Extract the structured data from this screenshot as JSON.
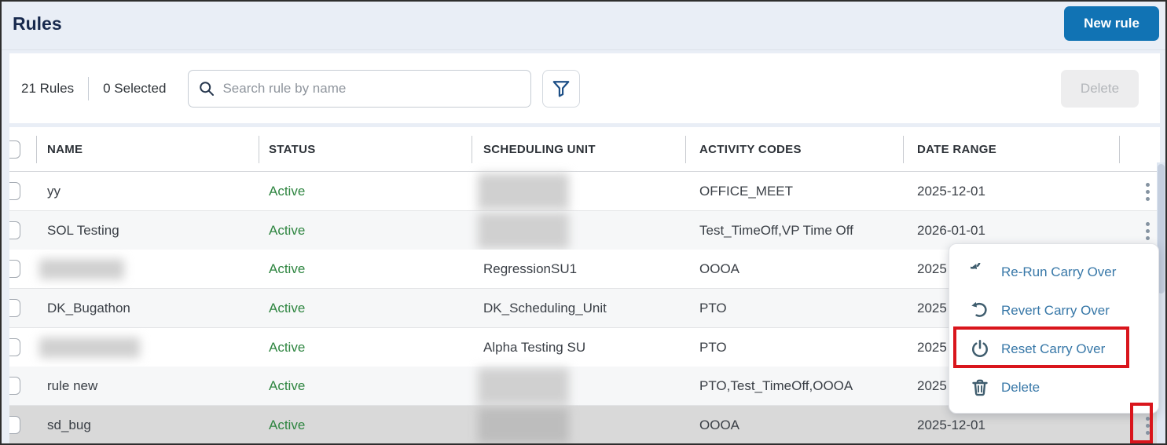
{
  "page": {
    "title": "Rules"
  },
  "header": {
    "new_rule_label": "New rule"
  },
  "toolbar": {
    "rules_count": "21 Rules",
    "selected_count": "0 Selected",
    "search_placeholder": "Search rule by name",
    "search_icon": "magnifier",
    "filter_icon": "filter-funnel",
    "delete_label": "Delete",
    "delete_enabled": false
  },
  "table": {
    "columns": [
      "NAME",
      "STATUS",
      "SCHEDULING UNIT",
      "ACTIVITY CODES",
      "DATE RANGE"
    ],
    "row_action_icon": "kebab-menu",
    "rows": [
      {
        "name": "yy",
        "status": "Active",
        "scheduling_unit": "",
        "scheduling_unit_redacted": true,
        "activity_codes": "OFFICE_MEET",
        "date_range": "2025-12-01",
        "selected": false
      },
      {
        "name": "SOL Testing",
        "status": "Active",
        "scheduling_unit": "",
        "scheduling_unit_redacted": true,
        "activity_codes": "Test_TimeOff,VP Time Off",
        "date_range": "2026-01-01",
        "selected": false
      },
      {
        "name": "",
        "name_redacted": true,
        "status": "Active",
        "scheduling_unit": "RegressionSU1",
        "activity_codes": "OOOA",
        "date_range": "2025",
        "date_occluded_by_menu": true,
        "selected": false
      },
      {
        "name": "DK_Bugathon",
        "status": "Active",
        "scheduling_unit": "DK_Scheduling_Unit",
        "activity_codes": "PTO",
        "date_range": "2025",
        "date_occluded_by_menu": true,
        "selected": false
      },
      {
        "name": "",
        "name_redacted": true,
        "status": "Active",
        "scheduling_unit": "Alpha Testing SU",
        "activity_codes": "PTO",
        "date_range": "2025",
        "date_occluded_by_menu": true,
        "selected": false
      },
      {
        "name": "rule new",
        "status": "Active",
        "scheduling_unit": "",
        "scheduling_unit_redacted": true,
        "activity_codes": "PTO,Test_TimeOff,OOOA",
        "date_range": "2025",
        "date_occluded_by_menu": true,
        "selected": false
      },
      {
        "name": "sd_bug",
        "status": "Active",
        "scheduling_unit": "",
        "scheduling_unit_redacted": true,
        "activity_codes": "OOOA",
        "date_range": "2025-12-01",
        "selected": true
      }
    ]
  },
  "context_menu": {
    "items": [
      {
        "label": "Re-Run Carry Over",
        "icon": "rerun-circular-arrow",
        "highlighted": false
      },
      {
        "label": "Revert Carry Over",
        "icon": "revert-undo-arrow",
        "highlighted": false
      },
      {
        "label": "Reset Carry Over",
        "icon": "power",
        "highlighted": true
      },
      {
        "label": "Delete",
        "icon": "trash",
        "highlighted": false
      }
    ]
  },
  "annotations": {
    "highlight_color": "#d9151c",
    "highlighted_menu_item": "Reset Carry Over",
    "highlighted_row_action": "sd_bug row kebab menu"
  },
  "colors": {
    "accent_blue": "#1173b4",
    "menu_link_blue": "#3878a8",
    "menu_icon_slate": "#3f5d6e",
    "status_active_green": "#2e8540",
    "page_background": "#e9eef6",
    "selected_row_gray": "#d9d9d9",
    "annotation_red": "#d9151c"
  }
}
